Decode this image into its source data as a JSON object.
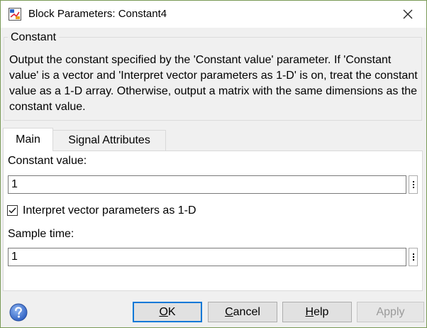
{
  "window": {
    "title": "Block Parameters: Constant4"
  },
  "group": {
    "title": "Constant",
    "description": "Output the constant specified by the 'Constant value' parameter. If 'Constant value' is a vector and 'Interpret vector parameters as 1-D' is on, treat the constant value as a 1-D array. Otherwise, output a matrix with the same dimensions as the constant value."
  },
  "tabs": [
    {
      "label": "Main",
      "active": true
    },
    {
      "label": "Signal Attributes",
      "active": false
    }
  ],
  "main": {
    "constant_value_label": "Constant value:",
    "constant_value": "1",
    "interpret_label": "Interpret vector parameters as 1-D",
    "interpret_checked": true,
    "sample_time_label": "Sample time:",
    "sample_time": "1"
  },
  "buttons": {
    "ok_first": "O",
    "ok_rest": "K",
    "cancel_first": "C",
    "cancel_rest": "ancel",
    "help_first": "H",
    "help_rest": "elp",
    "apply_label": "Apply"
  },
  "colors": {
    "window_border": "#7a9a57",
    "default_button_border": "#0078d7",
    "help_icon": "#3a6fd1",
    "disabled_text": "#9a9a9a"
  },
  "icons": {
    "app": "simulink-block-icon",
    "close": "close-icon",
    "help": "question-mark-icon",
    "more": "vertical-ellipsis-icon",
    "check": "checkmark-icon"
  }
}
